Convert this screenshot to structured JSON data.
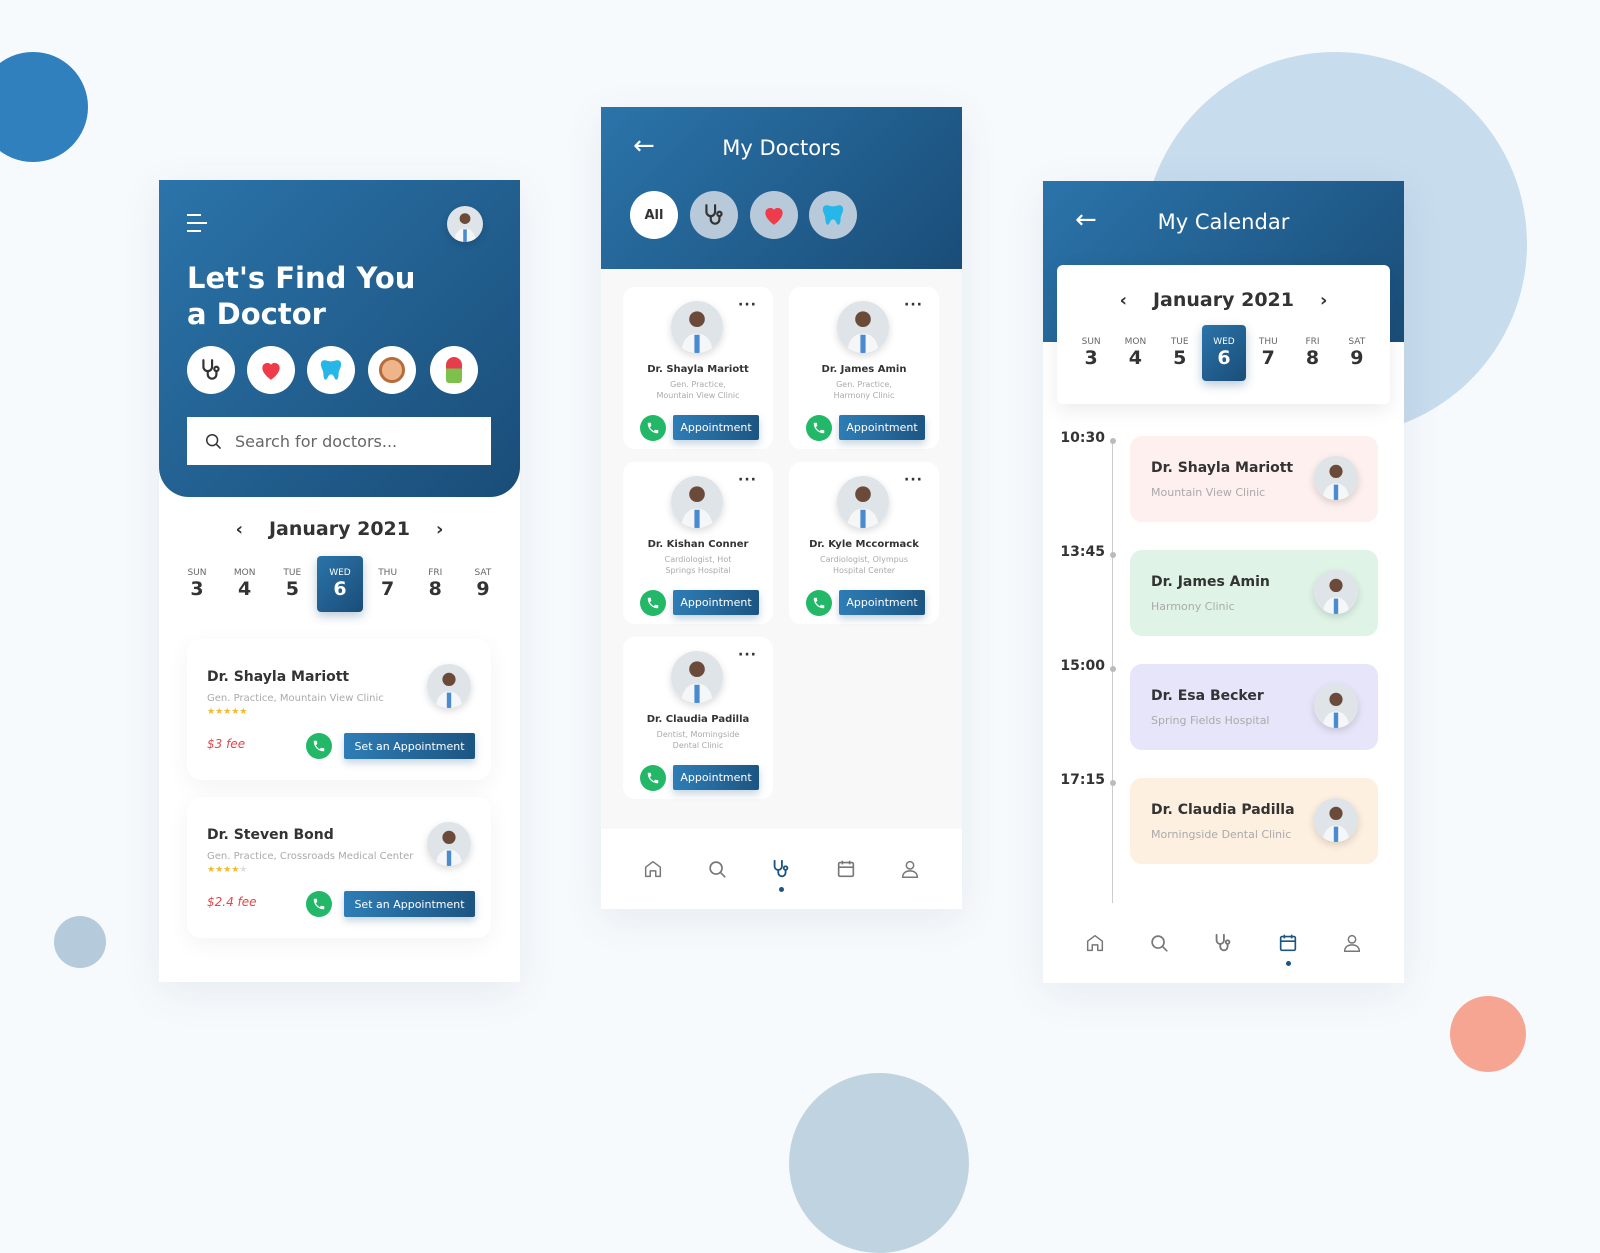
{
  "colors": {
    "primary": "#1c5582",
    "call": "#22b868",
    "fee": "#e0474c",
    "star": "#f5b82e"
  },
  "screen1": {
    "title_line1": "Let's Find You",
    "title_line2": "a Doctor",
    "categories": [
      "stethoscope-icon",
      "heart-icon",
      "tooth-icon",
      "baby-icon",
      "woman-icon"
    ],
    "search_placeholder": "Search for doctors...",
    "month": "January 2021",
    "days": [
      {
        "n": "SUN",
        "d": "3"
      },
      {
        "n": "MON",
        "d": "4"
      },
      {
        "n": "TUE",
        "d": "5"
      },
      {
        "n": "WED",
        "d": "6"
      },
      {
        "n": "THU",
        "d": "7"
      },
      {
        "n": "FRI",
        "d": "8"
      },
      {
        "n": "SAT",
        "d": "9"
      }
    ],
    "selected_day": "6",
    "doctors": [
      {
        "name": "Dr. Shayla Mariott",
        "spec": "Gen. Practice, Mountain View Clinic",
        "rating": 5,
        "fee": "$3 fee",
        "button": "Set an Appointment"
      },
      {
        "name": "Dr. Steven Bond",
        "spec": "Gen. Practice, Crossroads Medical Center",
        "rating": 4,
        "fee": "$2.4 fee",
        "button": "Set an Appointment"
      }
    ]
  },
  "screen2": {
    "title": "My Doctors",
    "filters": [
      "All",
      "stethoscope-icon",
      "heart-icon",
      "tooth-icon"
    ],
    "active_filter": "All",
    "doctors": [
      {
        "name": "Dr. Shayla Mariott",
        "spec1": "Gen. Practice,",
        "spec2": "Mountain View Clinic",
        "button": "Appointment"
      },
      {
        "name": "Dr. James Amin",
        "spec1": "Gen. Practice,",
        "spec2": "Harmony Clinic",
        "button": "Appointment"
      },
      {
        "name": "Dr. Kishan Conner",
        "spec1": "Cardiologist, Hot",
        "spec2": "Springs Hospital",
        "button": "Appointment"
      },
      {
        "name": "Dr. Kyle Mccormack",
        "spec1": "Cardiologist, Olympus",
        "spec2": "Hospital Center",
        "button": "Appointment"
      },
      {
        "name": "Dr. Claudia Padilla",
        "spec1": "Dentist, Morningside",
        "spec2": "Dental Clinic",
        "button": "Appointment"
      }
    ],
    "nav": [
      "home-icon",
      "search-icon",
      "stethoscope-icon",
      "calendar-icon",
      "profile-icon"
    ],
    "active_nav": "stethoscope-icon"
  },
  "screen3": {
    "title": "My Calendar",
    "month": "January 2021",
    "selected_day": "6",
    "appointments": [
      {
        "time": "10:30",
        "name": "Dr. Shayla Mariott",
        "clinic": "Mountain View Clinic",
        "color": "#fdf0ee"
      },
      {
        "time": "13:45",
        "name": "Dr. James Amin",
        "clinic": "Harmony Clinic",
        "color": "#dff4e7"
      },
      {
        "time": "15:00",
        "name": "Dr. Esa Becker",
        "clinic": "Spring Fields Hospital",
        "color": "#e7e5f9"
      },
      {
        "time": "17:15",
        "name": "Dr. Claudia Padilla",
        "clinic": "Morningside Dental Clinic",
        "color": "#fdf0e0"
      }
    ],
    "active_nav": "calendar-icon"
  }
}
